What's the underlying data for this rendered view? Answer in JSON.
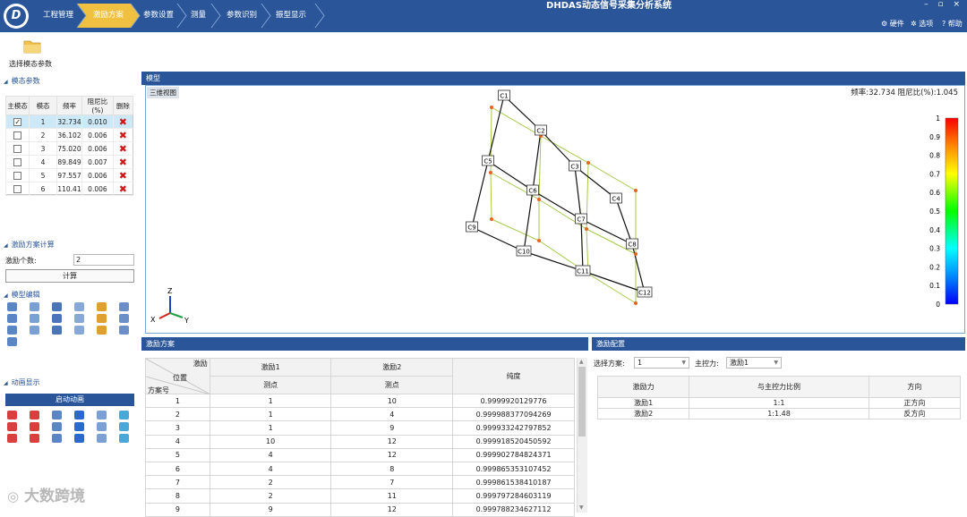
{
  "app": {
    "title": "DHDAS动态信号采集分析系统",
    "window_controls": "– ▫ ×"
  },
  "nav_tabs": [
    "工程管理",
    "激励方案",
    "参数设置",
    "测量",
    "参数识别",
    "振型显示"
  ],
  "active_tab": 1,
  "top_menu": {
    "hardware": "硬件",
    "options": "选项",
    "help": "帮助"
  },
  "toolbar": {
    "select_modal_params": "选择模态参数"
  },
  "left": {
    "modal_params_title": "模态参数",
    "modal_table": {
      "headers": [
        "主模态",
        "模态",
        "频率",
        "阻尼比(%)",
        "删除"
      ],
      "rows": [
        {
          "checked": true,
          "mode": "1",
          "freq": "32.734",
          "damp": "0.010"
        },
        {
          "checked": false,
          "mode": "2",
          "freq": "36.102",
          "damp": "0.006"
        },
        {
          "checked": false,
          "mode": "3",
          "freq": "75.020",
          "damp": "0.006"
        },
        {
          "checked": false,
          "mode": "4",
          "freq": "89.849",
          "damp": "0.007"
        },
        {
          "checked": false,
          "mode": "5",
          "freq": "97.557",
          "damp": "0.006"
        },
        {
          "checked": false,
          "mode": "6",
          "freq": "110.41",
          "damp": "0.006"
        }
      ]
    },
    "excitation_calc_title": "激励方案计算",
    "excitation_count_label": "激励个数:",
    "excitation_count_value": "2",
    "calc_button": "计算",
    "model_edit_title": "模型编辑",
    "animation_title": "动画显示",
    "start_animation": "启动动画"
  },
  "model_panel": {
    "title": "模型",
    "view_label": "三维视图",
    "info": "频率:32.734 阻尼比(%):1.045",
    "nodes": [
      "C1",
      "C2",
      "C3",
      "C4",
      "C5",
      "C6",
      "C7",
      "C8",
      "C9",
      "C10",
      "C11",
      "C12"
    ],
    "colorbar_ticks": [
      "1",
      "0.9",
      "0.8",
      "0.7",
      "0.6",
      "0.5",
      "0.4",
      "0.3",
      "0.2",
      "0.1",
      "0"
    ],
    "axes": {
      "z": "Z",
      "x": "X",
      "y": "Y"
    }
  },
  "scheme_panel": {
    "title": "激励方案",
    "header": {
      "corner_top": "激励",
      "corner_mid": "位置",
      "corner_bottom": "方案号",
      "exc1": "激励1",
      "exc2": "激励2",
      "point": "测点",
      "purity": "纯度"
    },
    "rows": [
      {
        "no": "1",
        "p1": "1",
        "p2": "10",
        "purity": "0.9999920129776"
      },
      {
        "no": "2",
        "p1": "1",
        "p2": "4",
        "purity": "0.999988377094269"
      },
      {
        "no": "3",
        "p1": "1",
        "p2": "9",
        "purity": "0.999933242797852"
      },
      {
        "no": "4",
        "p1": "10",
        "p2": "12",
        "purity": "0.999918520450592"
      },
      {
        "no": "5",
        "p1": "4",
        "p2": "12",
        "purity": "0.999902784824371"
      },
      {
        "no": "6",
        "p1": "4",
        "p2": "8",
        "purity": "0.999865353107452"
      },
      {
        "no": "7",
        "p1": "2",
        "p2": "7",
        "purity": "0.999861538410187"
      },
      {
        "no": "8",
        "p1": "2",
        "p2": "11",
        "purity": "0.999797284603119"
      },
      {
        "no": "9",
        "p1": "9",
        "p2": "12",
        "purity": "0.999788234627112"
      }
    ]
  },
  "config_panel": {
    "title": "激励配置",
    "select_scheme_label": "选择方案:",
    "select_scheme_value": "1",
    "main_force_label": "主控力:",
    "main_force_value": "激励1",
    "headers": [
      "激励力",
      "与主控力比例",
      "方向"
    ],
    "rows": [
      {
        "force": "激励1",
        "ratio": "1:1",
        "dir": "正方向"
      },
      {
        "force": "激励2",
        "ratio": "1:1.48",
        "dir": "反方向"
      }
    ]
  },
  "watermark": "大数跨境",
  "colors": {
    "primary": "#2a5699",
    "active_tab": "#f0c040",
    "deformed_mesh": "#a6c94a",
    "node_dot": "#e8641e"
  }
}
